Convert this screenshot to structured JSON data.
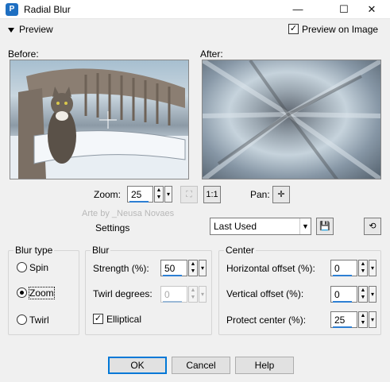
{
  "window": {
    "title": "Radial Blur",
    "app_icon": "paint-app-icon"
  },
  "window_controls": {
    "minimize": "—",
    "maximize": "☐",
    "close": "✕"
  },
  "preview": {
    "toggle_label": "Preview",
    "preview_on_image_label": "Preview on Image",
    "preview_on_image_checked": true
  },
  "images": {
    "before_label": "Before:",
    "after_label": "After:"
  },
  "zoom": {
    "label": "Zoom:",
    "value": "25"
  },
  "pan": {
    "label": "Pan:"
  },
  "watermark": "Arte by _Neusa Novaes",
  "settings": {
    "label": "Settings",
    "selected": "Last Used"
  },
  "blur_type": {
    "title": "Blur type",
    "options": [
      {
        "label": "Spin",
        "selected": false
      },
      {
        "label": "Zoom",
        "selected": true
      },
      {
        "label": "Twirl",
        "selected": false
      }
    ]
  },
  "blur": {
    "title": "Blur",
    "strength_label": "Strength (%):",
    "strength_value": "50",
    "twirl_label": "Twirl degrees:",
    "twirl_value": "0",
    "elliptical_label": "Elliptical",
    "elliptical_checked": true
  },
  "center": {
    "title": "Center",
    "horizontal_label": "Horizontal offset (%):",
    "horizontal_value": "0",
    "vertical_label": "Vertical offset (%):",
    "vertical_value": "0",
    "protect_label": "Protect center (%):",
    "protect_value": "25"
  },
  "buttons": {
    "ok": "OK",
    "cancel": "Cancel",
    "help": "Help"
  }
}
